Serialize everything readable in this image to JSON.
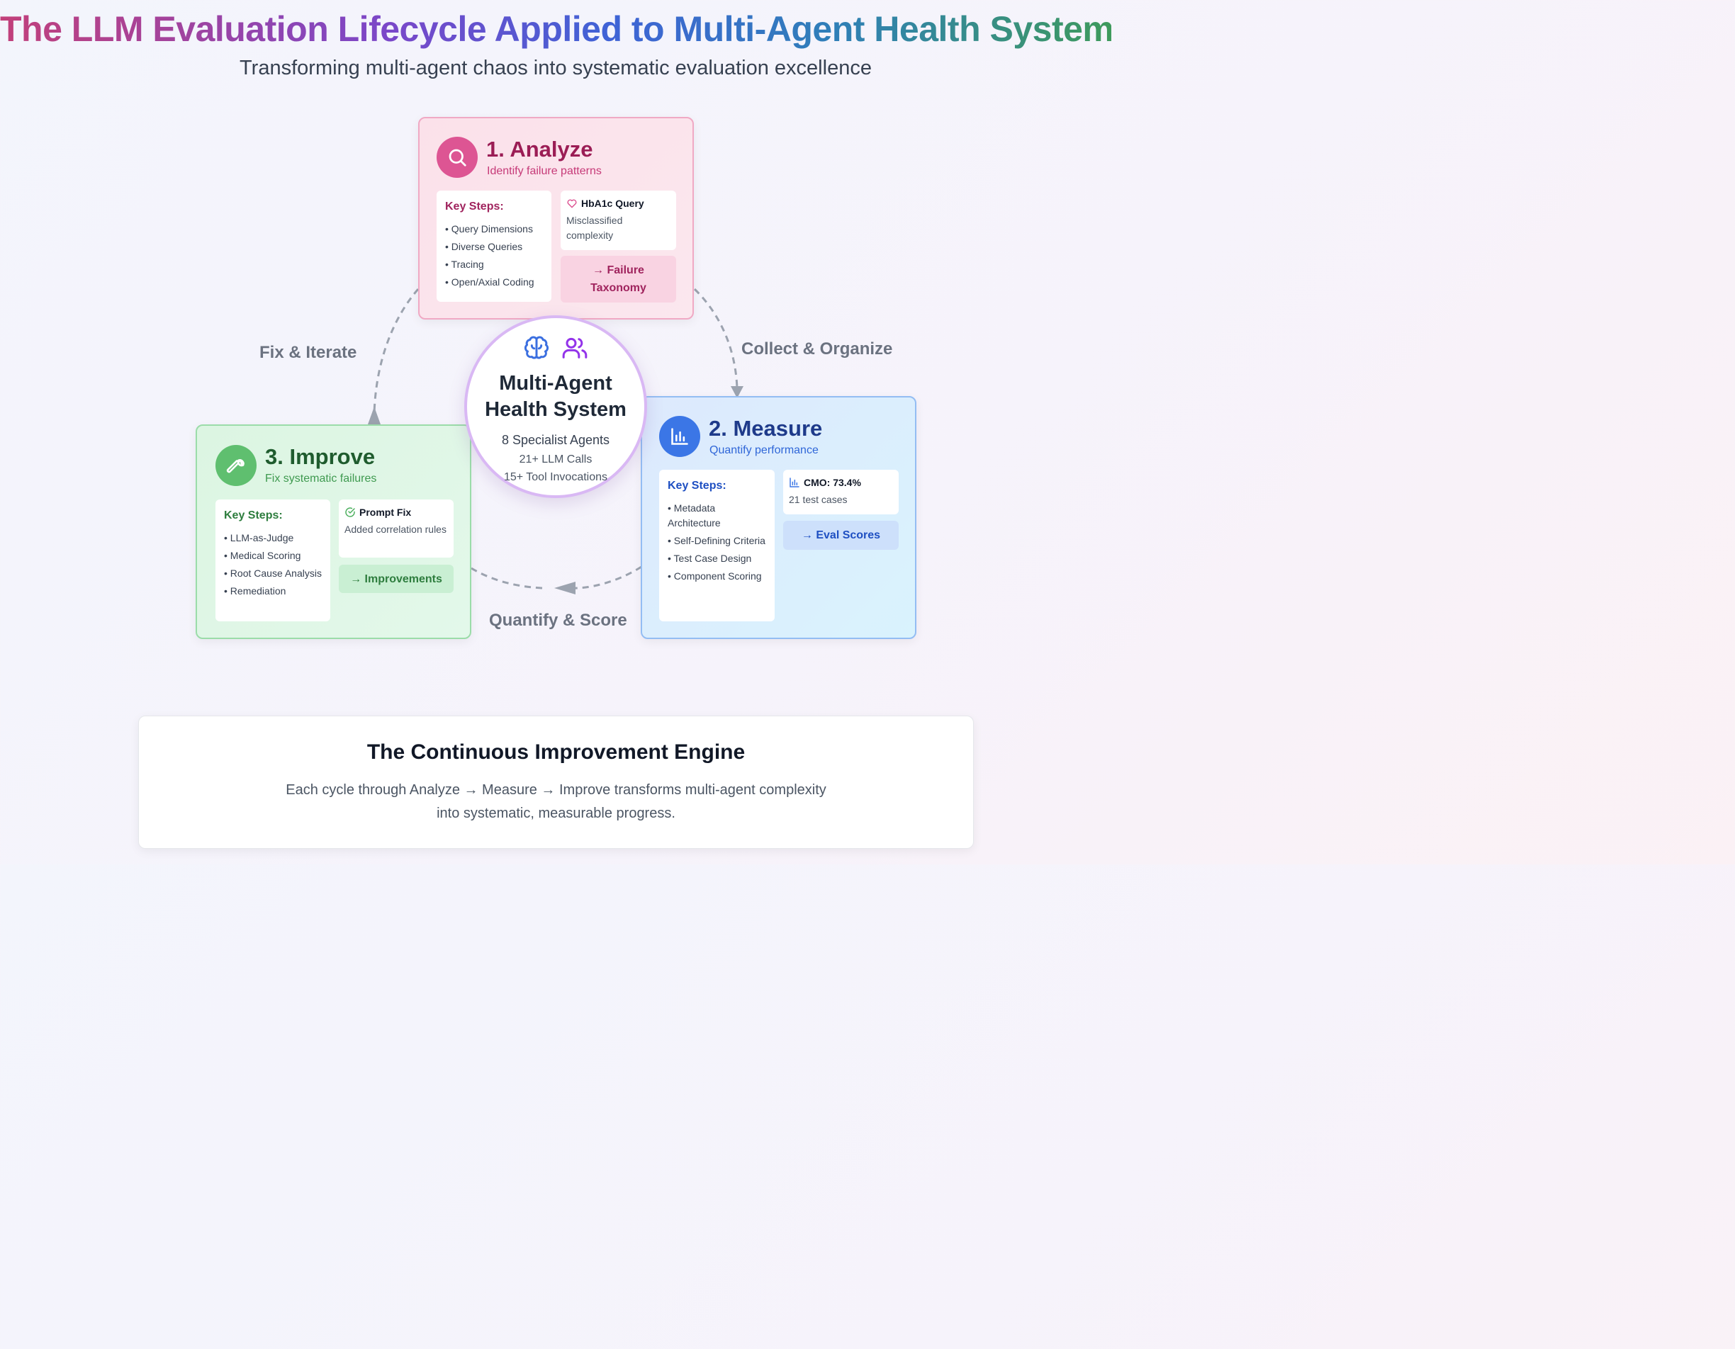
{
  "header": {
    "title": "The LLM Evaluation Lifecycle Applied to Multi-Agent Health Systems",
    "subtitle": "Transforming multi-agent chaos into systematic evaluation excellence"
  },
  "cycle_labels": {
    "collect": "Collect & Organize",
    "quantify": "Quantify & Score",
    "fix": "Fix & Iterate"
  },
  "center": {
    "title_line1": "Multi-Agent",
    "title_line2": "Health System",
    "stat1": "8 Specialist Agents",
    "stat2": "21+ LLM Calls",
    "stat3": "15+ Tool Invocations",
    "icons": [
      "brain-icon",
      "users-icon"
    ]
  },
  "analyze": {
    "title": "1. Analyze",
    "tagline": "Identify failure patterns",
    "icon": "search-icon",
    "steps_title": "Key Steps:",
    "steps": [
      "Query Dimensions",
      "Diverse Queries",
      "Tracing",
      "Open/Axial Coding"
    ],
    "example_title": "HbA1c Query",
    "example_icon": "heart-icon",
    "example_body": "Misclassified complexity",
    "outcome_line1": "→ Failure",
    "outcome_line2": "Taxonomy",
    "colors": {
      "accent": "#dd5593",
      "title": "#9b1d55",
      "tagline": "#c63a78"
    }
  },
  "measure": {
    "title": "2. Measure",
    "tagline": "Quantify performance",
    "icon": "bar-chart-icon",
    "steps_title": "Key Steps:",
    "steps": [
      "Metadata Architecture",
      "Self-Defining Criteria",
      "Test Case Design",
      "Component Scoring"
    ],
    "example_title": "CMO: 73.4%",
    "example_icon": "bar-chart-icon",
    "example_body": "21 test cases",
    "outcome": "→ Eval Scores",
    "colors": {
      "accent": "#3b76e6",
      "title": "#1e3a8a",
      "tagline": "#2f66d8"
    }
  },
  "improve": {
    "title": "3. Improve",
    "tagline": "Fix systematic failures",
    "icon": "wrench-icon",
    "steps_title": "Key Steps:",
    "steps": [
      "LLM-as-Judge",
      "Medical Scoring",
      "Root Cause Analysis",
      "Remediation"
    ],
    "example_title": "Prompt Fix",
    "example_icon": "check-circle-icon",
    "example_body": "Added correlation rules",
    "outcome": "→ Improvements",
    "colors": {
      "accent": "#5fbf6f",
      "title": "#1f5c2e",
      "tagline": "#3f9a50"
    }
  },
  "engine": {
    "title": "The Continuous Improvement Engine",
    "text_line1": "Each cycle through Analyze → Measure → Improve transforms multi-agent complexity",
    "text_line2": "into systematic, measurable progress."
  }
}
